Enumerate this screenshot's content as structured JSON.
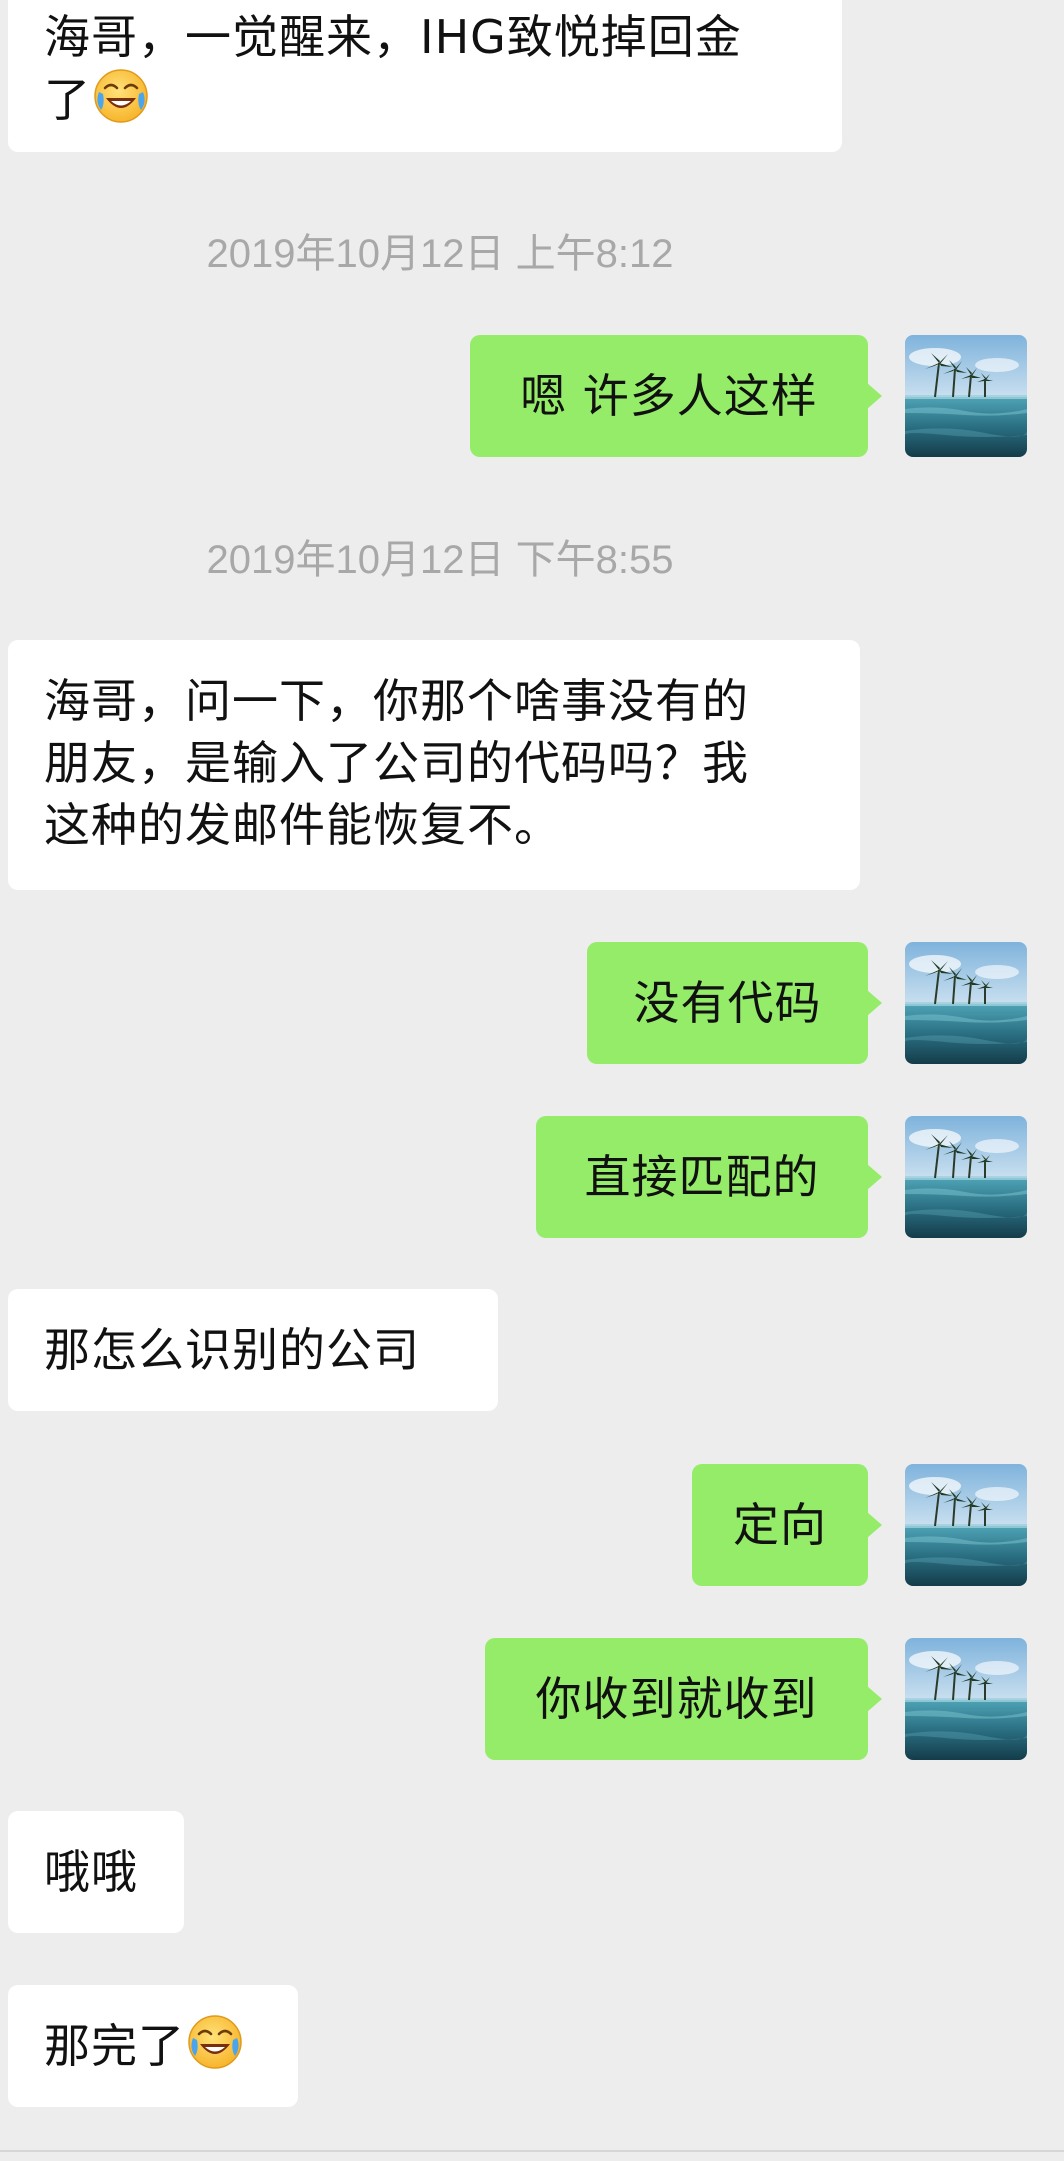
{
  "timestamps": [
    "2019年10月12日 上午8:12",
    "2019年10月12日 下午8:55"
  ],
  "messages": {
    "m1": {
      "from": "other",
      "lines": [
        "海哥，一觉醒来，IHG致悦掉回金",
        "了"
      ],
      "emoji": "crying-laughing-emoji"
    },
    "m2": {
      "from": "me",
      "text": "嗯 许多人这样"
    },
    "m3": {
      "from": "other",
      "lines": [
        "海哥，问一下，你那个啥事没有的",
        "朋友，是输入了公司的代码吗？我",
        "这种的发邮件能恢复不。"
      ]
    },
    "m4": {
      "from": "me",
      "text": "没有代码"
    },
    "m5": {
      "from": "me",
      "text": "直接匹配的"
    },
    "m6": {
      "from": "other",
      "text": "那怎么识别的公司"
    },
    "m7": {
      "from": "me",
      "text": "定向"
    },
    "m8": {
      "from": "me",
      "text": "你收到就收到"
    },
    "m9": {
      "from": "other",
      "text": "哦哦"
    },
    "m10": {
      "from": "other",
      "text": "那完了",
      "emoji": "crying-laughing-emoji"
    }
  },
  "avatar": {
    "icon": "avatar-infinity-pool-palm-trees"
  },
  "colors": {
    "background": "#ededed",
    "bubble_me": "#95ec69",
    "bubble_other": "#ffffff",
    "timestamp": "#a8a8a8"
  }
}
